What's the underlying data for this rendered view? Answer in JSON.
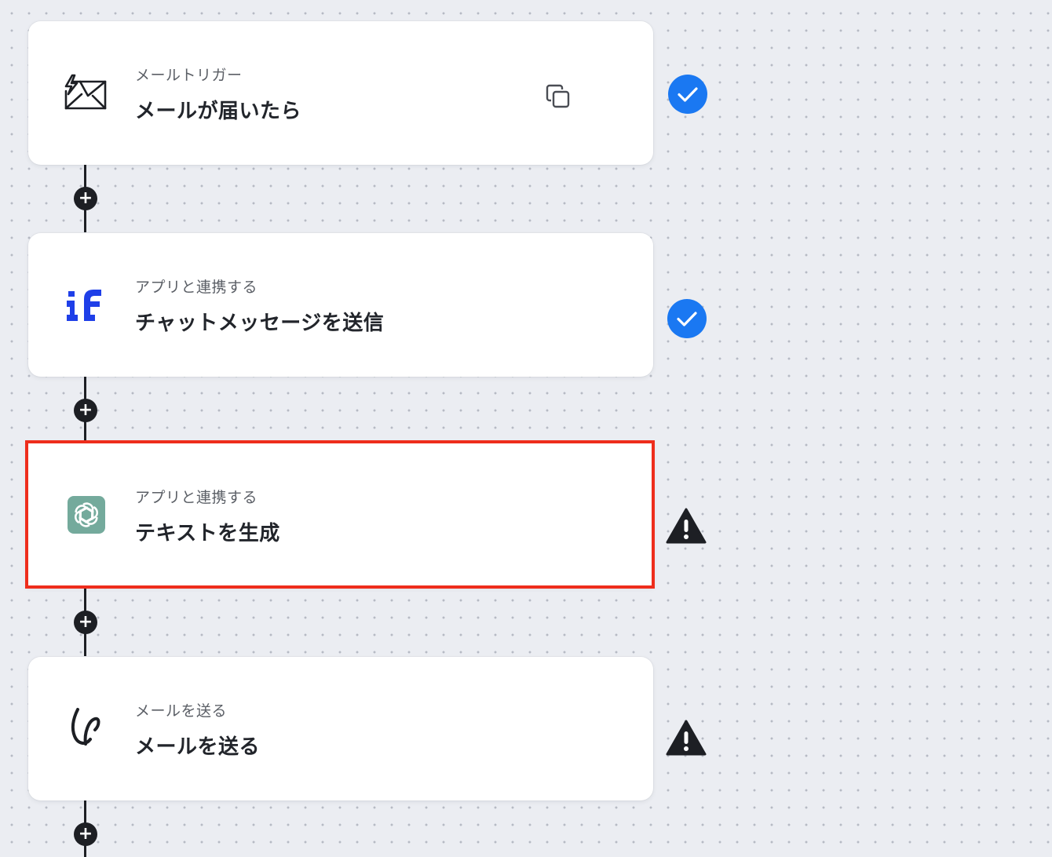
{
  "steps": [
    {
      "subtitle": "メールトリガー",
      "title": "メールが届いたら",
      "icon": "mail-trigger-icon",
      "status": "success"
    },
    {
      "subtitle": "アプリと連携する",
      "title": "チャットメッセージを送信",
      "icon": "if-app-icon",
      "status": "success"
    },
    {
      "subtitle": "アプリと連携する",
      "title": "テキストを生成",
      "icon": "chatgpt-icon",
      "status": "warning",
      "selected": true
    },
    {
      "subtitle": "メールを送る",
      "title": "メールを送る",
      "icon": "send-mail-icon",
      "status": "warning"
    }
  ],
  "add_step_symbol": "+",
  "colors": {
    "success": "#1a78f2",
    "warning": "#1d1f24",
    "selected_outline": "#ee2d1c",
    "if_logo": "#1f3fe8",
    "chatgpt_bg": "#74aa9c"
  }
}
